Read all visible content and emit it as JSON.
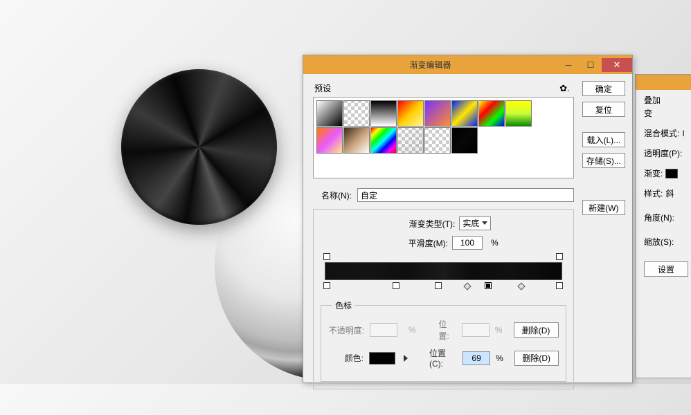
{
  "dialog": {
    "title": "渐变编辑器",
    "buttons": {
      "ok": "确定",
      "reset": "复位",
      "load": "载入(L)...",
      "save": "存储(S)...",
      "new": "新建(W)"
    },
    "preset_label": "预设",
    "name_label": "名称(N):",
    "name_value": "自定",
    "grad_type_label": "渐变类型(T):",
    "grad_type_value": "实底",
    "smooth_label": "平滑度(M):",
    "smooth_value": "100",
    "stops_legend": "色标",
    "opacity_label": "不透明度:",
    "opacity_hint": "",
    "pos1_label": "位置:",
    "pos1_value": "",
    "del1": "删除(D)",
    "color_label": "颜色:",
    "pos2_label": "位置(C):",
    "pos2_value": "69",
    "del2": "删除(D)",
    "pct": "%"
  },
  "panel2": {
    "tab": "叠加",
    "sub": "变",
    "blend": "混合模式:",
    "blend_val": "І",
    "opacity": "透明度(P):",
    "gradient": "渐变:",
    "style": "样式:",
    "style_val": "斜",
    "angle": "角度(N):",
    "scale": "缩放(S):",
    "settings": "设置"
  }
}
